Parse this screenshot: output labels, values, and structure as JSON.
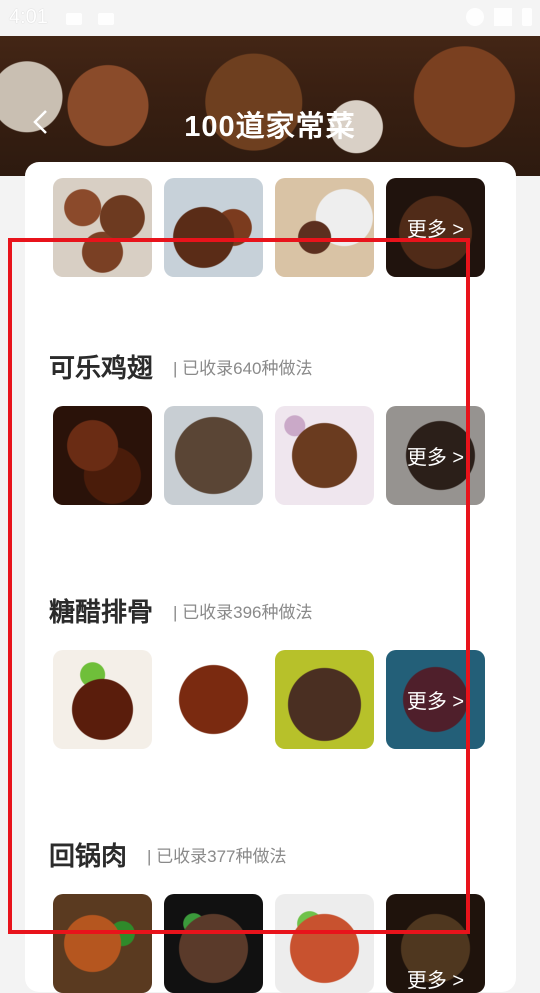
{
  "status_bar": {
    "time": "4:01"
  },
  "header": {
    "title": "100道家常菜"
  },
  "top_row": {
    "more_label": "更多 >"
  },
  "sections": [
    {
      "title": "可乐鸡翅",
      "subtitle": "| 已收录640种做法",
      "more_label": "更多 >"
    },
    {
      "title": "糖醋排骨",
      "subtitle": "| 已收录396种做法",
      "more_label": "更多 >"
    },
    {
      "title": "回锅肉",
      "subtitle": "| 已收录377种做法",
      "more_label": "更多 >"
    }
  ],
  "colors": {
    "highlight": "#e8131b",
    "title_text": "#2b2b2b",
    "sub_text": "#8a8a8a"
  },
  "icons": [
    "back-arrow-icon",
    "wifi-icon",
    "battery-icon",
    "notification-icon"
  ]
}
